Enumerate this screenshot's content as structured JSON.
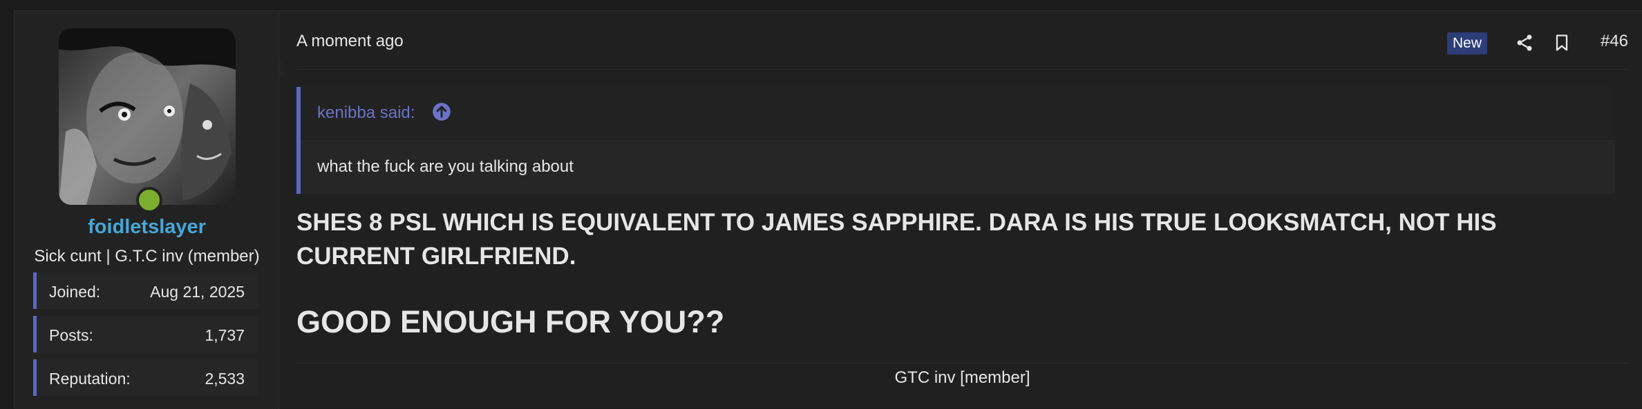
{
  "user": {
    "username": "foidletslayer",
    "title": "Sick cunt | G.T.C inv (member)",
    "online": true,
    "stats": [
      {
        "label": "Joined:",
        "value": "Aug 21, 2025"
      },
      {
        "label": "Posts:",
        "value": "1,737"
      },
      {
        "label": "Reputation:",
        "value": "2,533"
      }
    ]
  },
  "post": {
    "time": "A moment ago",
    "badge": "New",
    "number": "#46",
    "quote": {
      "author": "kenibba said:",
      "text": "what the fuck are you talking about"
    },
    "message_line": "SHES 8 PSL WHICH IS EQUIVALENT TO JAMES SAPPHIRE. DARA IS HIS TRUE LOOKSMATCH, NOT HIS CURRENT GIRLFRIEND.",
    "message_big": "GOOD ENOUGH FOR YOU??",
    "signature": "GTC inv [member]"
  },
  "colors": {
    "accent": "#5b67c8",
    "username": "#45a7d8",
    "online": "#7cae2d",
    "badge": "#2d3d78"
  },
  "icons": [
    "share-icon",
    "bookmark-icon",
    "arrow-up-circle-icon"
  ]
}
